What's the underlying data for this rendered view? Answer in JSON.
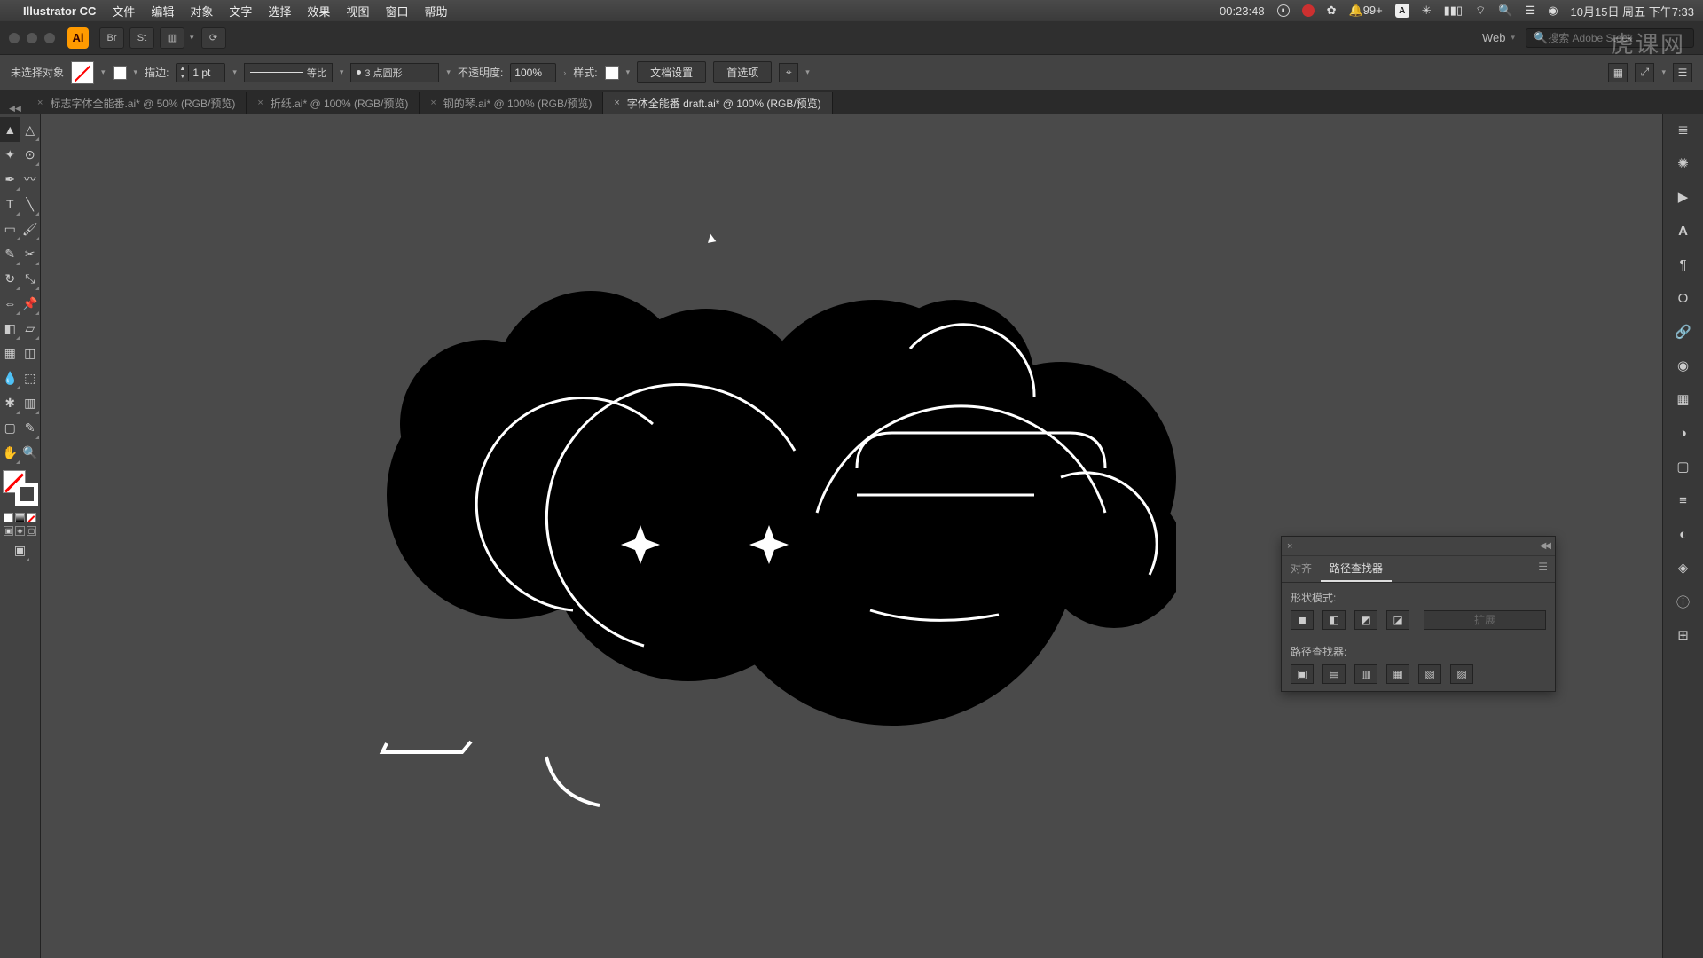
{
  "menubar": {
    "app": "Illustrator CC",
    "items": [
      "文件",
      "编辑",
      "对象",
      "文字",
      "选择",
      "效果",
      "视图",
      "窗口",
      "帮助"
    ],
    "timer": "00:23:48",
    "notif": "99+",
    "input_badge": "A",
    "date": "10月15日 周五 下午7:33"
  },
  "titlebar": {
    "ai": "Ai",
    "bridge": "Br",
    "stock": "St",
    "doc_profile": "Web",
    "search_placeholder": "搜索 Adobe Stock"
  },
  "control": {
    "selection": "未选择对象",
    "stroke_label": "描边:",
    "stroke_weight": "1 pt",
    "stroke_ratio": "等比",
    "profile_label": "3 点圆形",
    "opacity_label": "不透明度:",
    "opacity_value": "100%",
    "style_label": "样式:",
    "doc_setup": "文档设置",
    "prefs": "首选项"
  },
  "tabs": [
    {
      "label": "标志字体全能番.ai* @ 50% (RGB/预览)",
      "active": false
    },
    {
      "label": "折纸.ai* @ 100% (RGB/预览)",
      "active": false
    },
    {
      "label": "钢的琴.ai* @ 100% (RGB/预览)",
      "active": false
    },
    {
      "label": "字体全能番 draft.ai* @ 100% (RGB/预览)",
      "active": true
    }
  ],
  "pathfinder": {
    "tab_align": "对齐",
    "tab_pathfinder": "路径查找器",
    "shape_modes": "形状模式:",
    "pathfinders": "路径查找器:",
    "expand": "扩展"
  },
  "watermark": "虎课网"
}
